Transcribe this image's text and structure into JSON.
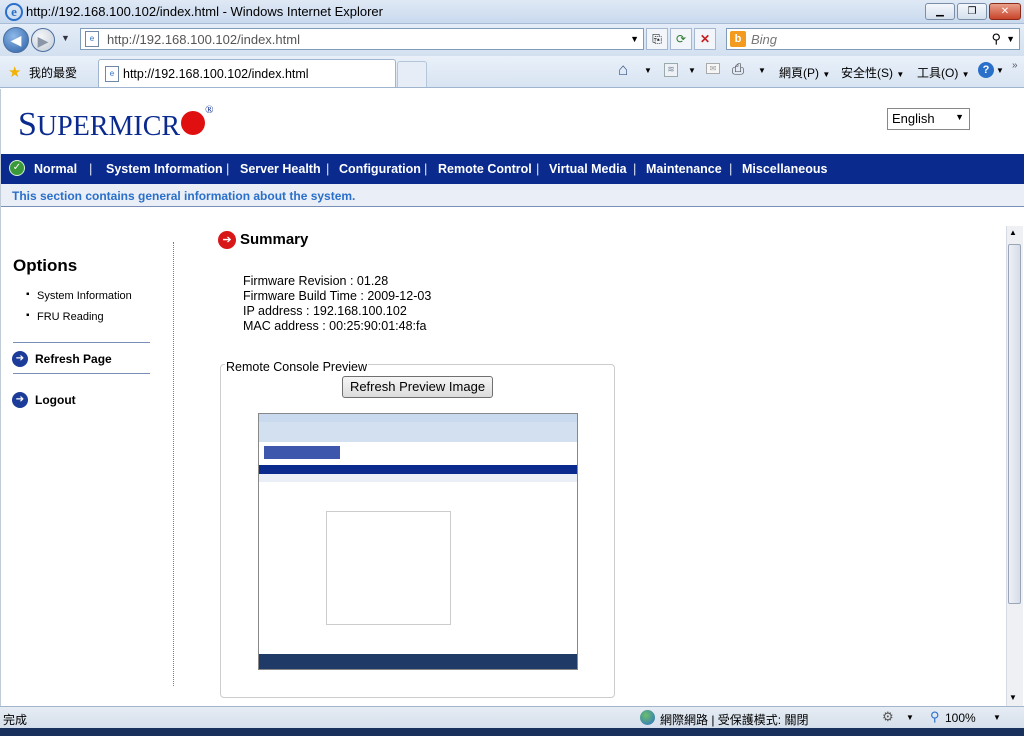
{
  "window": {
    "title": "http://192.168.100.102/index.html - Windows Internet Explorer"
  },
  "browser": {
    "url": "http://192.168.100.102/index.html",
    "search_placeholder": "Bing",
    "favorites_label": "我的最愛",
    "tab_title": "http://192.168.100.102/index.html",
    "menu": {
      "page": "網頁(P)",
      "safety": "安全性(S)",
      "tools": "工具(O)"
    }
  },
  "page": {
    "brand": {
      "text_s": "S",
      "text_rest": "UPERMICR",
      "reg": "®"
    },
    "language": "English",
    "nav": [
      "Normal",
      "System Information",
      "Server Health",
      "Configuration",
      "Remote Control",
      "Virtual Media",
      "Maintenance",
      "Miscellaneous"
    ],
    "info_text": "This section contains general information about the system.",
    "sidebar": {
      "heading": "Options",
      "items": [
        "System Information",
        "FRU Reading"
      ],
      "refresh": "Refresh Page",
      "logout": "Logout"
    },
    "summary": {
      "title": "Summary",
      "lines": [
        "Firmware Revision : 01.28",
        "Firmware Build Time : 2009-12-03",
        "IP address : 192.168.100.102",
        "MAC address : 00:25:90:01:48:fa"
      ]
    },
    "preview": {
      "legend": "Remote Console Preview",
      "button": "Refresh Preview Image"
    }
  },
  "statusbar": {
    "status": "完成",
    "zone": "網際網路 | 受保護模式: 關閉",
    "zoom": "100%"
  },
  "colors": {
    "brand_blue": "#0a2a8e",
    "info_text": "#2a6fc9",
    "logo_red": "#e01010"
  }
}
